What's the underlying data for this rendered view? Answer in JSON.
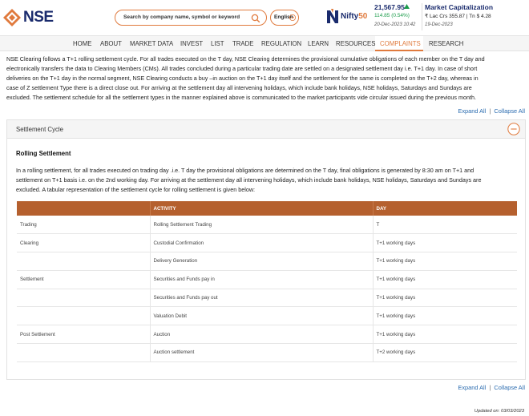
{
  "header": {
    "logo_text": "NSE",
    "search_placeholder": "Search by company name, symbol or keyword",
    "language": "English",
    "nifty": {
      "logo_text": "Nifty",
      "logo_suffix": "50",
      "value": "21,567.95",
      "change": "114.85 (0.54%)",
      "date": "20-Dec-2023 10:42",
      "trend": "up"
    },
    "market_cap": {
      "title": "Market Capitalization",
      "value": "₹ Lac Crs 355.87 | Tn $ 4.28",
      "date": "19-Dec-2023"
    }
  },
  "nav": {
    "items": [
      "HOME",
      "ABOUT",
      "MARKET DATA",
      "INVEST",
      "LIST",
      "TRADE",
      "REGULATION",
      "LEARN",
      "RESOURCES",
      "COMPLAINTS",
      "RESEARCH"
    ],
    "active": "COMPLAINTS"
  },
  "intro": {
    "lines": [
      "NSE Clearing follows a T+1 rolling settlement cycle. For all trades executed on the T day, NSE Clearing determines the provisional cumulative obligations of each member on the T day and",
      "electronically transfers the data to Clearing Members (CMs). All trades concluded during a particular trading date are settled on a designated settlement day i.e. T+1 day. In case of short",
      "deliveries on the T+1 day in the normal segment, NSE Clearing conducts a buy –in auction on the T+1 day itself and the settlement for the same is completed on the T+2 day, whereas in",
      "case of Z  settlement Type  there is a direct close out. For arriving at the settlement day all intervening holidays, which include bank holidays, NSE holidays, Saturdays and Sundays are",
      "excluded. The settlement schedule for all the settlement types in the manner explained above is communicated to the market participants vide circular issued during the previous month."
    ]
  },
  "controls": {
    "expand_all": "Expand All",
    "separator": "|",
    "collapse_all": "Collapse All"
  },
  "panel": {
    "title": "Settlement Cycle",
    "subtitle": "Rolling Settlement",
    "description_lines": [
      "In a rolling settlement, for all trades executed on trading day .i.e. T day the provisional obligations are determined on the T day, final obligations is generated by 8:30 am on T+1 and",
      "settlement on T+1 basis i.e. on the 2nd working day. For arriving at the settlement day all intervening holidays, which include bank holidays, NSE holidays, Saturdays and Sundays are",
      "excluded. A tabular representation of the settlement cycle for rolling settlement is given below:"
    ],
    "table": {
      "headers": [
        "",
        "ACTIVITY",
        "DAY"
      ],
      "rows": [
        [
          "Trading",
          "Rolling Settlement Trading",
          "T"
        ],
        [
          "Clearing",
          "Custodial Confirmation",
          "T+1 working days"
        ],
        [
          "",
          "Delivery Generation",
          "T+1 working days"
        ],
        [
          "Settlement",
          "Securities and Funds pay in",
          "T+1 working days"
        ],
        [
          "",
          "Securities and Funds pay out",
          "T+1 working days"
        ],
        [
          "",
          "Valuation Debit",
          "T+1 working days"
        ],
        [
          "Post Settlement",
          "Auction",
          "T+1 working days"
        ],
        [
          "",
          "Auction settlement",
          "T+2 working days"
        ]
      ]
    }
  },
  "footer": {
    "updated": "Updated on: 03/03/2023"
  },
  "colors": {
    "accent": "#e07a3d",
    "brand": "#1a2b6d",
    "table_header": "#b5602e",
    "positive": "#1a9b4a",
    "link": "#2b6cb0"
  }
}
